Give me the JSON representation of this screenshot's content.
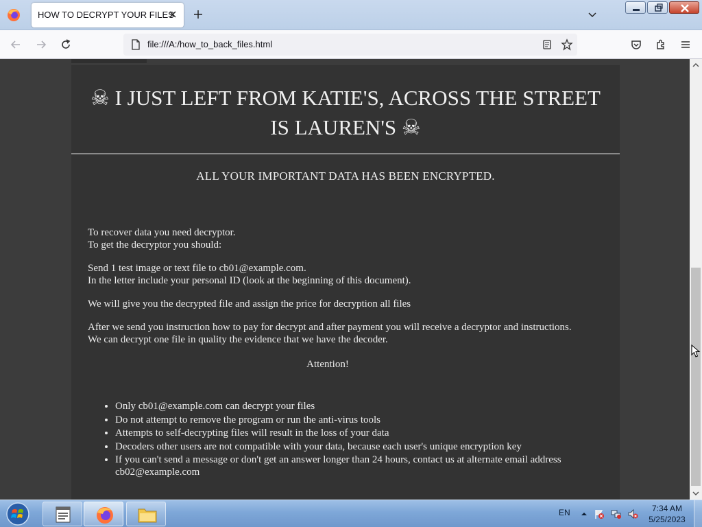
{
  "browser": {
    "tab_title": "HOW TO DECRYPT YOUR FILES",
    "url": "file:///A:/how_to_back_files.html"
  },
  "note": {
    "title_line1": "☠ I JUST LEFT FROM KATIE'S, ACROSS THE STREET",
    "title_line2": "IS LAUREN'S ☠",
    "headline": "ALL YOUR IMPORTANT DATA HAS BEEN ENCRYPTED.",
    "paragraphs": {
      "p1_line1": "To recover data you need decryptor.",
      "p1_line2": "To get the decryptor you should:",
      "p2_line1": "Send 1 test image or text file to cb01@example.com.",
      "p2_line2": "In the letter include your personal ID (look at the beginning of this document).",
      "p3": "We will give you the decrypted file and assign the price for decryption all files",
      "p4": "After we send you instruction how to pay for decrypt and after payment you will receive a decryptor and instructions. We can decrypt one file in quality the evidence that we have the decoder."
    },
    "attention": "Attention!",
    "bullets": [
      "Only cb01@example.com can decrypt your files",
      "Do not attempt to remove the program or run the anti-virus tools",
      "Attempts to self-decrypting files will result in the loss of your data",
      "Decoders other users are not compatible with your data, because each user's unique encryption key",
      "If you can't send a message or don't get an answer longer than 24 hours, contact us at alternate email address cb02@example.com"
    ]
  },
  "taskbar": {
    "language": "EN",
    "time": "7:34 AM",
    "date": "5/25/2023"
  },
  "colors": {
    "page_background": "#3c3c3c",
    "note_background": "#333333",
    "note_text": "#ececec",
    "taskbar": "#7ea7d8"
  }
}
